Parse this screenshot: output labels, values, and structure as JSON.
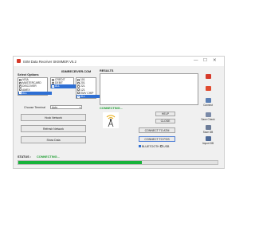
{
  "window": {
    "title": "ISIM Data Receiver SKIMMER V5.2",
    "controls": [
      "—",
      "☐",
      "✕"
    ]
  },
  "select_options": {
    "heading": "Select Options",
    "col1": [
      {
        "label": "VISA",
        "checked": false
      },
      {
        "label": "MASTERCARD",
        "checked": false
      },
      {
        "label": "DISCOVER",
        "checked": false
      },
      {
        "label": "AMEX",
        "checked": false
      },
      {
        "label": "ALL",
        "checked": true
      }
    ],
    "col2": [
      {
        "label": "CREDIT",
        "checked": false
      },
      {
        "label": "DEBIT",
        "checked": false
      },
      {
        "label": "ALL",
        "checked": true
      }
    ],
    "col3": [
      {
        "label": "101",
        "checked": false
      },
      {
        "label": "201",
        "checked": false
      },
      {
        "label": "221",
        "checked": false
      },
      {
        "label": "121",
        "checked": false
      },
      {
        "label": "EMV CHIP",
        "checked": false
      },
      {
        "label": "ALL",
        "checked": true
      }
    ]
  },
  "site": "ISIMRECEIVER.COM",
  "results": {
    "label": "RESULTS",
    "value": ""
  },
  "terminal": {
    "label": "Choose Terminal",
    "value": "Auto"
  },
  "buttons": {
    "hook": "Hook Network",
    "refresh": "Refresh Network",
    "show": "Show Data",
    "help": "HELP",
    "close": "CLOSE",
    "atm": "CONNECT TO ATM",
    "pos": "CONNECT TO POS"
  },
  "connecting_text": "CONNECTING...",
  "checks": {
    "bluetooth": {
      "label": "BLUETOOTH",
      "checked": true
    },
    "usb": {
      "label": "USB",
      "checked": false
    }
  },
  "side": [
    {
      "label": "",
      "icon": "card-red-icon"
    },
    {
      "label": "",
      "icon": "card-red-icon"
    },
    {
      "label": "Connect",
      "icon": "connect-icon"
    },
    {
      "label": "Save Check",
      "icon": "save-check-icon"
    },
    {
      "label": "Save DB",
      "icon": "save-db-icon"
    },
    {
      "label": "Import DB",
      "icon": "import-db-icon"
    }
  ],
  "status": {
    "label": "STATUS :",
    "value": "CONNECTING...",
    "progress": 0.62
  },
  "colors": {
    "accent": "#2e6fd4",
    "progress": "#17b33a",
    "status_green": "#1a9c2e"
  }
}
